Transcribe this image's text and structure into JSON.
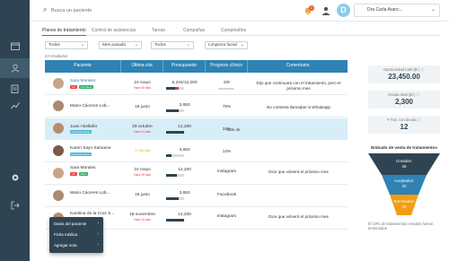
{
  "search": {
    "placeholder": "Busca un paciente"
  },
  "header": {
    "notification_count": "3",
    "avatar_letter": "D",
    "user_name": "Dra Carla Aranc..."
  },
  "tabs": [
    {
      "label": "Planes de tratamiento"
    },
    {
      "label": "Control de asistencias"
    },
    {
      "label": "Tareas"
    },
    {
      "label": "Campañas"
    },
    {
      "label": "Cumpleaños"
    }
  ],
  "filters": [
    {
      "value": "Todos"
    },
    {
      "value": "Mes pasado"
    },
    {
      "value": "Todos"
    },
    {
      "value": "Limpieza facial"
    }
  ],
  "results_label": "23 resultados",
  "table": {
    "headers": [
      "Paciente",
      "Última cita",
      "Presupuesto",
      "Progreso clínico",
      "Comentario"
    ],
    "rows": [
      {
        "name": "Sara Morales",
        "badges": [
          "VIP",
          "Completo"
        ],
        "date": "24 mayo",
        "date_sub": "Hace 45 días",
        "amount": "6,234/12,200",
        "progress": "5/9",
        "comment": "Dijo que continuará con el tratamiento, pero el próximo mes"
      },
      {
        "name": "Mario Cáceres Lob...",
        "badges": [],
        "date": "15 junio",
        "date_sub": "",
        "amount": "3,650",
        "progress": "75%",
        "comment": "No contesta llamadas ni Whatsapp"
      },
      {
        "name": "Juan Abellaño",
        "badges": [
          "Progreso activo"
        ],
        "date": "29 octubre",
        "date_sub": "Hace 41 días",
        "amount": "12,200",
        "progress": "34%",
        "comment": "todo ok"
      },
      {
        "name": "Karen Sayo Samame",
        "badges": [
          "Progreso activo"
        ],
        "date": "Sin cita",
        "date_sub": "",
        "amount": "3,650",
        "progress": "14%",
        "comment": ""
      },
      {
        "name": "Sara Morales",
        "badges": [
          "VIP",
          "Mixto"
        ],
        "date": "24 mayo",
        "date_sub": "Hace 45 días",
        "amount": "12,200",
        "progress": "Instagram",
        "comment": "Dice que volverá el próximo mes"
      },
      {
        "name": "Mario Cáceres Lob...",
        "badges": [],
        "date": "15 junio",
        "date_sub": "",
        "amount": "3,650",
        "progress": "Facebook",
        "comment": ""
      },
      {
        "name": "Karolina de la Cruz S...",
        "badges": [],
        "date": "18 noviembre",
        "date_sub": "Hace 15 días",
        "amount": "12,200",
        "progress": "Instagram",
        "comment": "Dice que volverá el próximo mes"
      }
    ]
  },
  "stats": [
    {
      "label": "Oportunidad total ($/.) ⓘ",
      "value": "23,450.00"
    },
    {
      "label": "Deuda total ($/.) ⓘ",
      "value": "2,300"
    },
    {
      "label": "# Trat. con deuda ⓘ",
      "value": "12"
    }
  ],
  "funnel": {
    "title": "Embudo de venta de tratamientos",
    "stages": [
      {
        "name": "Creados:",
        "value": "45",
        "color": "#2f4453"
      },
      {
        "name": "Aceptados:",
        "value": "20",
        "color": "#2f82b3"
      },
      {
        "name": "Terminados:",
        "value": "08",
        "color": "#f39c12"
      }
    ],
    "note": "El 10% de tratamientos creados fueron terminados."
  },
  "context_menu": {
    "items": [
      "Datos del paciente",
      "Ficha médica",
      "Agregar nota"
    ]
  },
  "colors": {
    "sidebar": "#2f4453",
    "accent": "#2f82b3",
    "danger": "#e64242",
    "highlight_row": "#d7eef8"
  },
  "icons": [
    "calendar-icon",
    "user-icon",
    "clipboard-icon",
    "chart-icon",
    "settings-icon",
    "logout-icon",
    "search-icon",
    "bell-icon"
  ]
}
